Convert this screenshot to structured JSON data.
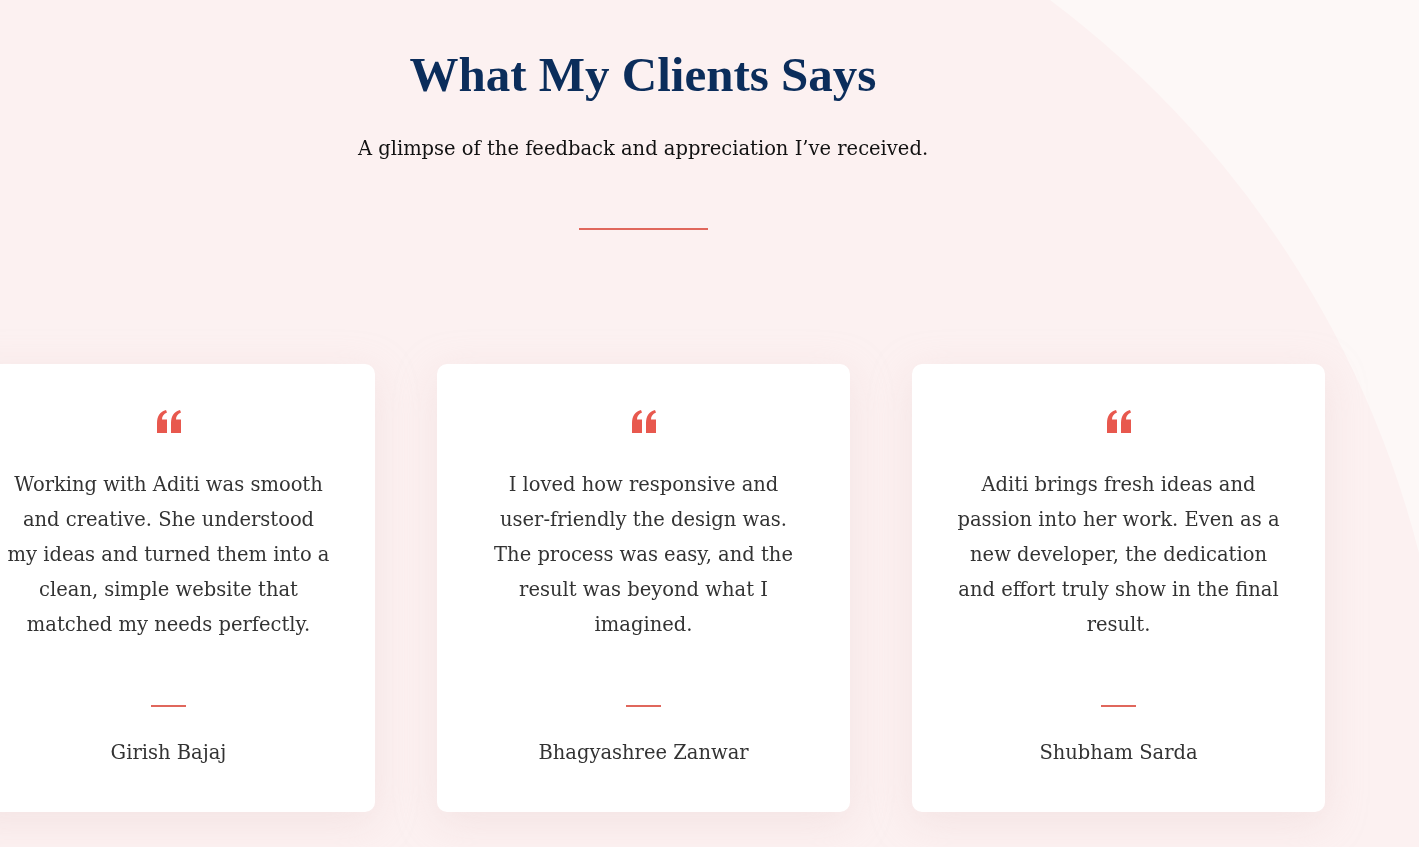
{
  "header": {
    "title": "What My Clients Says",
    "subtitle": "A glimpse of the feedback and appreciation I’ve received."
  },
  "testimonials": [
    {
      "quote": "Working with Aditi was smooth and creative. She understood my ideas and turned them into a clean, simple website that matched my needs perfectly.",
      "name": "Girish Bajaj"
    },
    {
      "quote": "I loved how responsive and user-friendly the design was. The process was easy, and the result was beyond what I imagined.",
      "name": "Bhagyashree Zanwar"
    },
    {
      "quote": "Aditi brings fresh ideas and passion into her work. Even as a new developer, the dedication and effort truly show in the final result.",
      "name": "Shubham Sarda"
    }
  ]
}
